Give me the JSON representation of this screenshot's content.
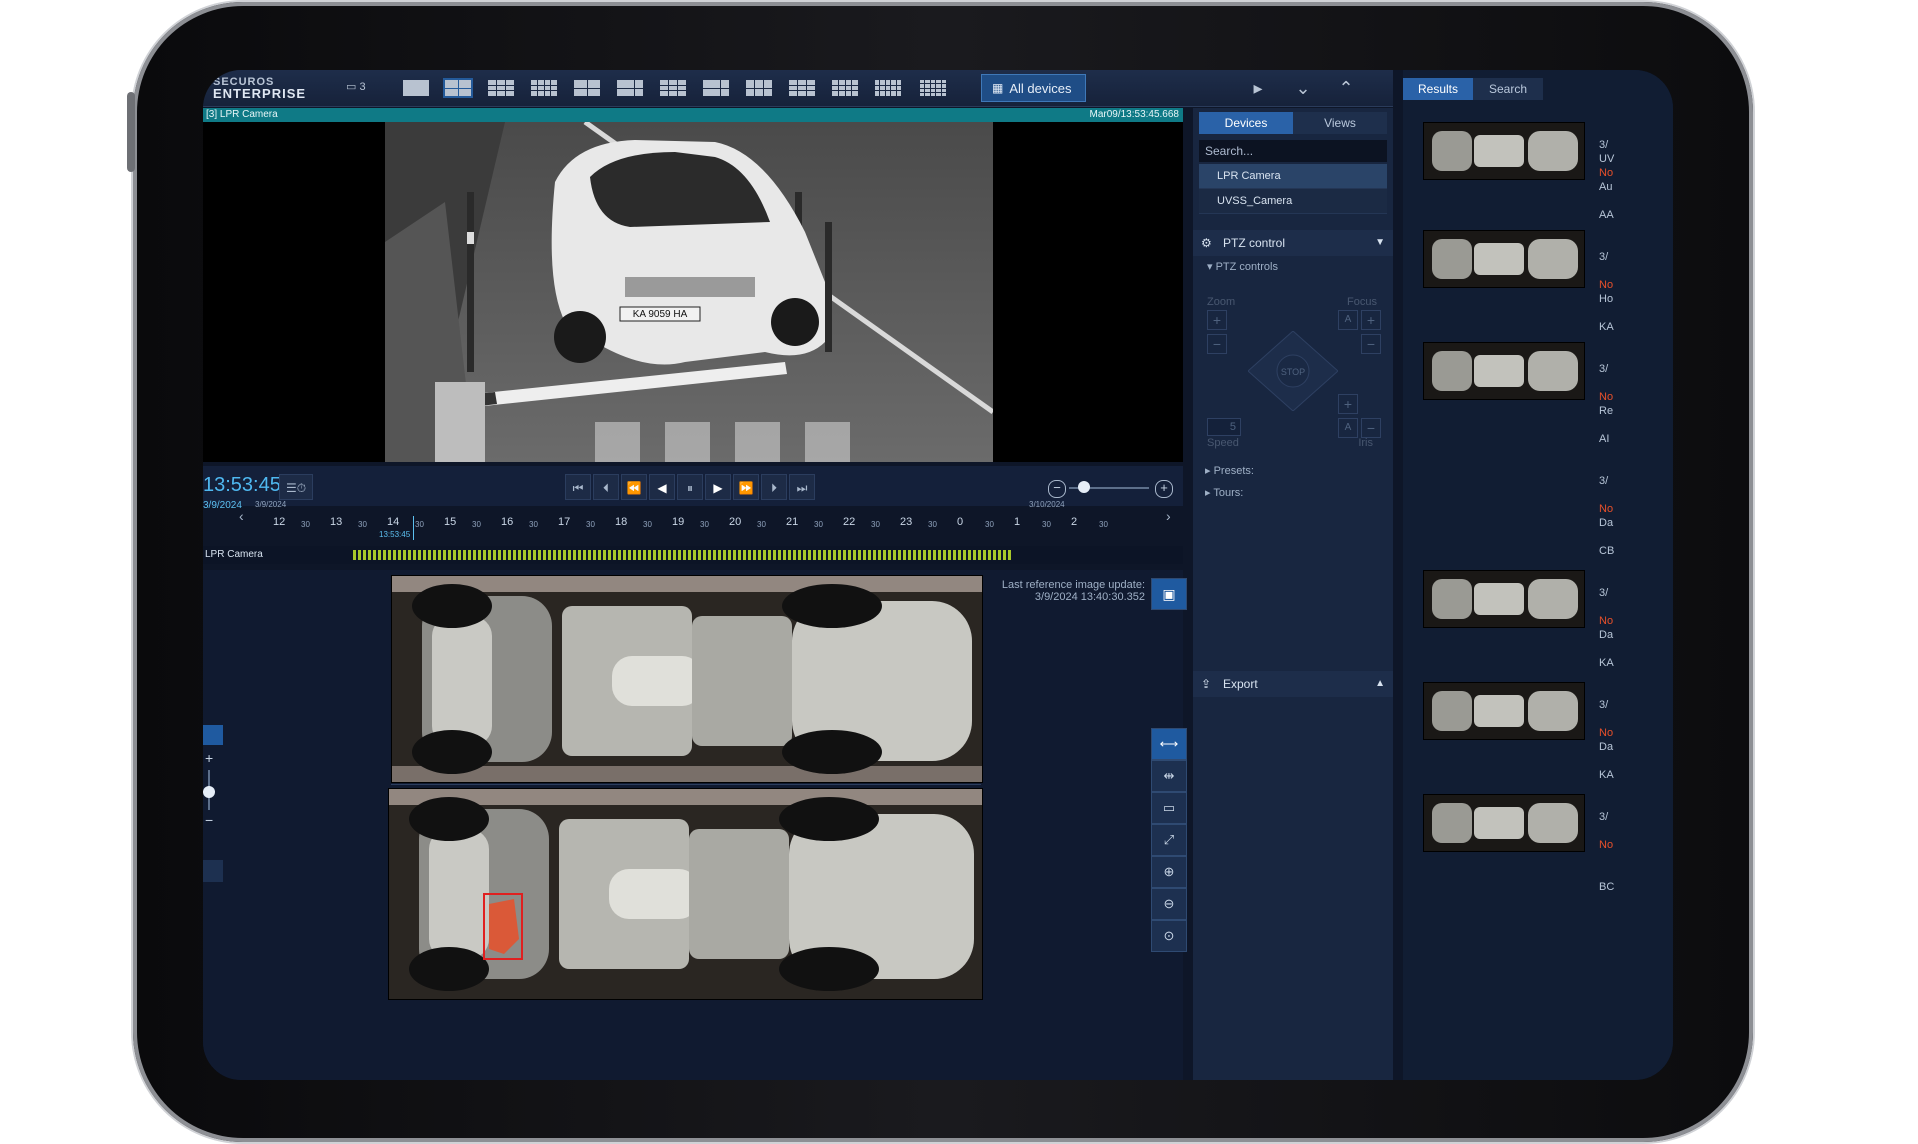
{
  "app": {
    "logo_line1": "SECUROS",
    "logo_line2": "ENTERPRISE",
    "monitor_count": "3"
  },
  "toolbar": {
    "all_devices": "All devices"
  },
  "camera": {
    "name": "[3] LPR Camera",
    "timestamp": "Mar09/13:53:45.668",
    "plate": "KA 9059 HA"
  },
  "playback": {
    "time": "13:53:45",
    "date": "3/9/2024",
    "timeline_dates": [
      "3/9/2024",
      "3/10/2024"
    ],
    "hours": [
      "12",
      "13",
      "14",
      "15",
      "16",
      "17",
      "18",
      "19",
      "20",
      "21",
      "22",
      "23",
      "0",
      "1",
      "2"
    ],
    "half": "30",
    "cursor_time": "13:53:45",
    "track_label": "LPR Camera"
  },
  "uvss": {
    "ref_update_label": "Last reference image update:",
    "ref_update_time": "3/9/2024 13:40:30.352"
  },
  "devices_panel": {
    "tabs": [
      "Devices",
      "Views"
    ],
    "search_placeholder": "Search...",
    "items": [
      "LPR Camera",
      "UVSS_Camera"
    ]
  },
  "ptz": {
    "header": "PTZ control",
    "controls_label": "PTZ controls",
    "zoom": "Zoom",
    "focus": "Focus",
    "stop": "STOP",
    "speed_value": "5",
    "speed_label": "Speed",
    "iris": "Iris",
    "presets": "Presets:",
    "tours": "Tours:"
  },
  "export": {
    "label": "Export"
  },
  "results_panel": {
    "tabs": [
      "Results",
      "Search"
    ],
    "rows": [
      {
        "date": "3/",
        "lines": [
          "UV",
          "No",
          "Au",
          "",
          "AA"
        ]
      },
      {
        "date": "3/",
        "lines": [
          "",
          "No",
          "Ho",
          "",
          "KA"
        ]
      },
      {
        "date": "3/",
        "lines": [
          "",
          "No",
          "Re",
          "",
          "AI"
        ]
      },
      {
        "date": "3/",
        "lines": [
          "",
          "No",
          "Da",
          "",
          "CB"
        ]
      },
      {
        "date": "3/",
        "lines": [
          "",
          "No",
          "Da",
          "",
          "KA"
        ]
      },
      {
        "date": "3/",
        "lines": [
          "",
          "No",
          "Da",
          "",
          "KA"
        ]
      },
      {
        "date": "3/",
        "lines": [
          "",
          "No",
          "",
          "",
          "BC"
        ]
      }
    ]
  },
  "colors": {
    "accent": "#2a62a8",
    "teal": "#0f7a86",
    "alert": "#e8502a",
    "track": "#a8c82a"
  }
}
